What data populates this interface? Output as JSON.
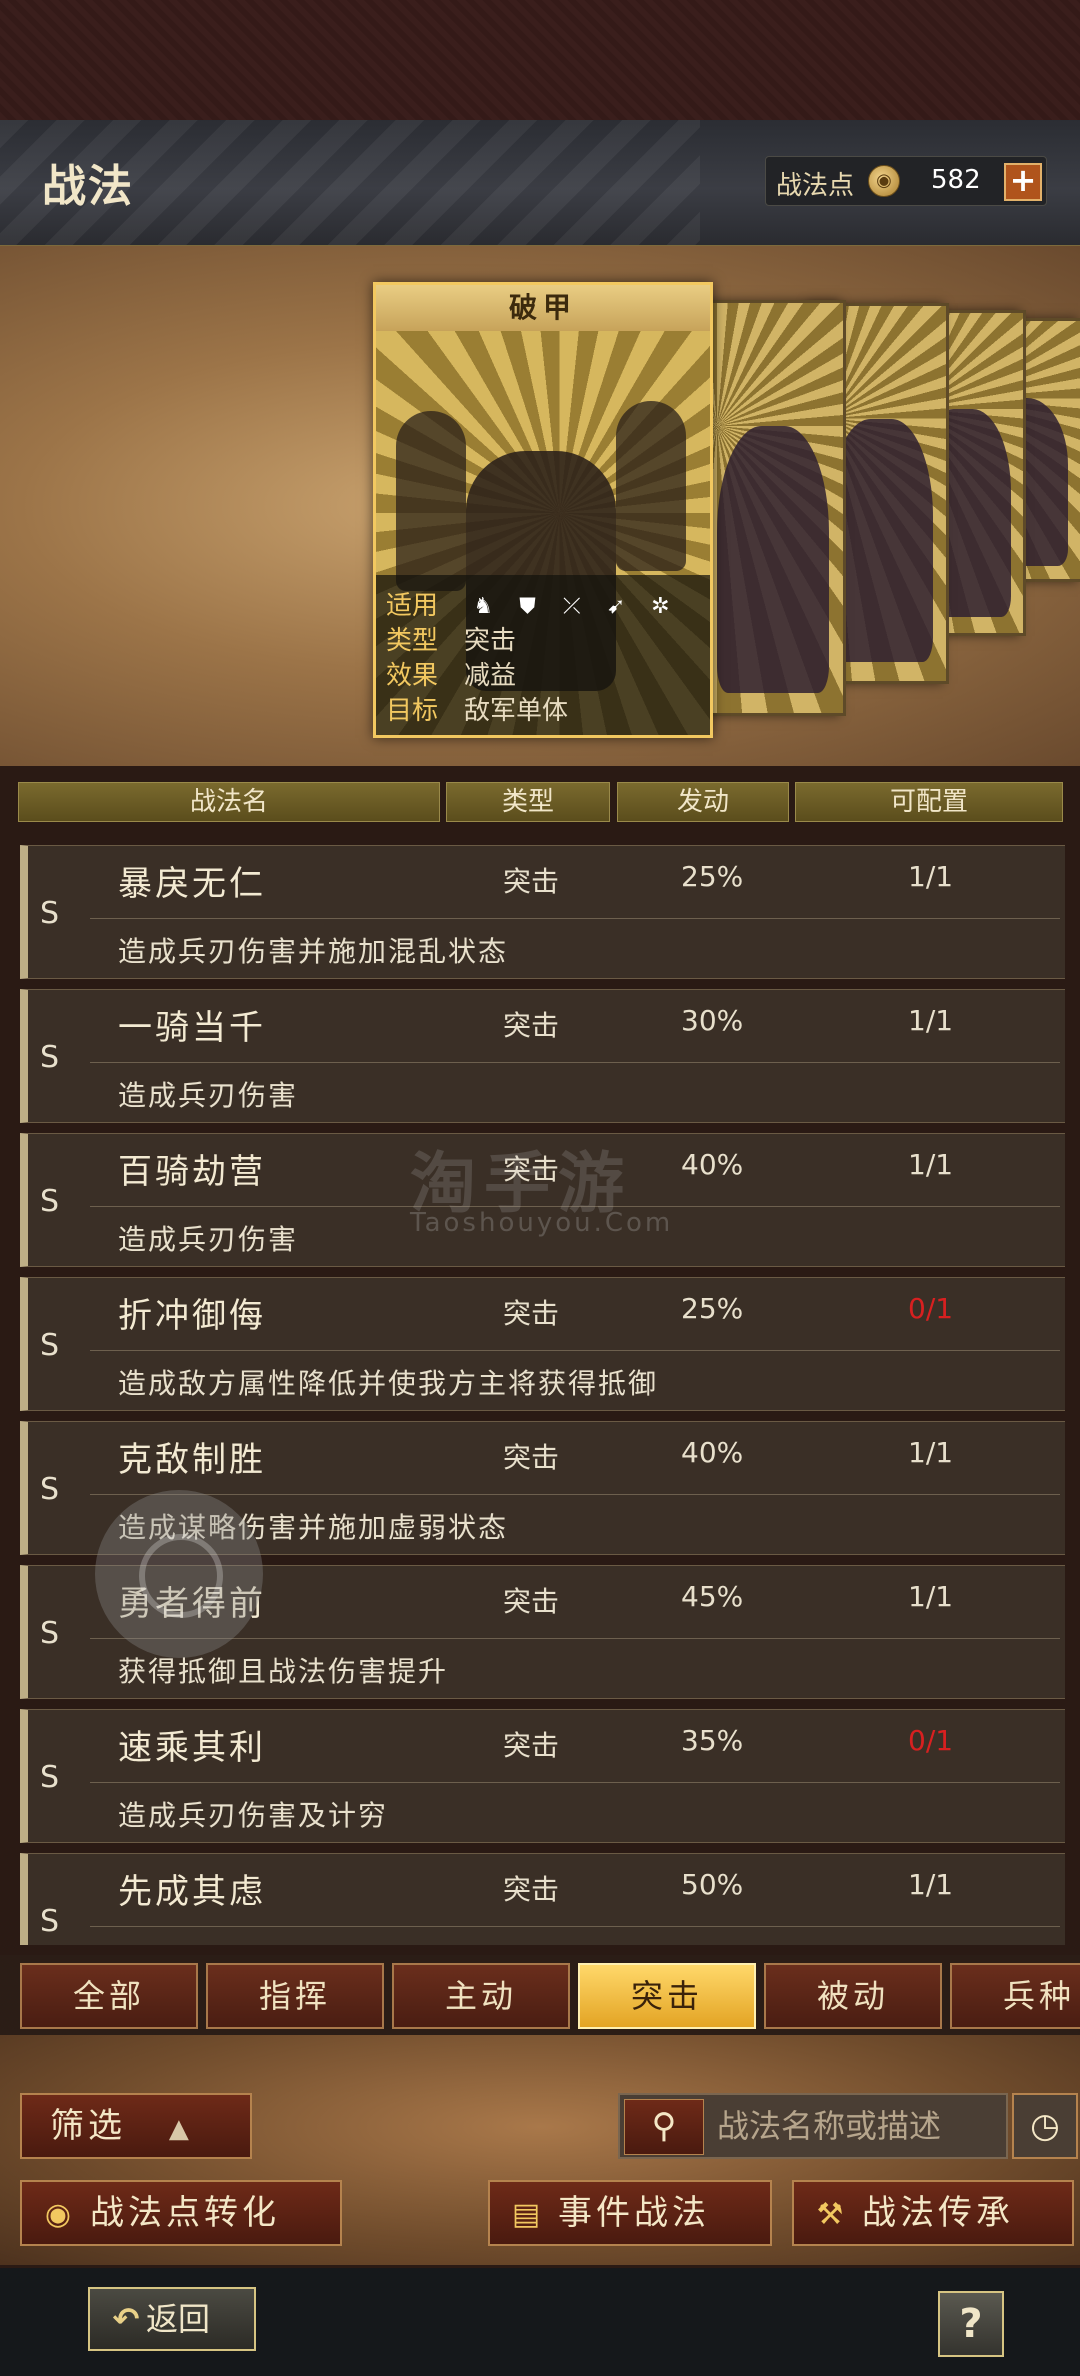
{
  "header": {
    "title": "战法",
    "points_label": "战法点",
    "points_value": "582",
    "plus_label": "+"
  },
  "featured_card": {
    "name": "破甲",
    "rows": [
      {
        "key": "适用",
        "value": ""
      },
      {
        "key": "类型",
        "value": "突击"
      },
      {
        "key": "效果",
        "value": "减益"
      },
      {
        "key": "目标",
        "value": "敌军单体"
      }
    ],
    "unit_icons": [
      "cavalry-icon",
      "shield-icon",
      "bow-icon",
      "spear-icon",
      "wheel-icon"
    ]
  },
  "table_headers": {
    "name": "战法名",
    "type": "类型",
    "rate": "发动",
    "config": "可配置"
  },
  "skills": [
    {
      "grade": "S",
      "name": "暴戾无仁",
      "type": "突击",
      "rate": "25%",
      "config": "1/1",
      "config_red": false,
      "desc": "造成兵刃伤害并施加混乱状态"
    },
    {
      "grade": "S",
      "name": "一骑当千",
      "type": "突击",
      "rate": "30%",
      "config": "1/1",
      "config_red": false,
      "desc": "造成兵刃伤害"
    },
    {
      "grade": "S",
      "name": "百骑劫营",
      "type": "突击",
      "rate": "40%",
      "config": "1/1",
      "config_red": false,
      "desc": "造成兵刃伤害"
    },
    {
      "grade": "S",
      "name": "折冲御侮",
      "type": "突击",
      "rate": "25%",
      "config": "0/1",
      "config_red": true,
      "desc": "造成敌方属性降低并使我方主将获得抵御"
    },
    {
      "grade": "S",
      "name": "克敌制胜",
      "type": "突击",
      "rate": "40%",
      "config": "1/1",
      "config_red": false,
      "desc": "造成谋略伤害并施加虚弱状态"
    },
    {
      "grade": "S",
      "name": "勇者得前",
      "type": "突击",
      "rate": "45%",
      "config": "1/1",
      "config_red": false,
      "desc": "获得抵御且战法伤害提升"
    },
    {
      "grade": "S",
      "name": "速乘其利",
      "type": "突击",
      "rate": "35%",
      "config": "0/1",
      "config_red": true,
      "desc": "造成兵刃伤害及计穷"
    },
    {
      "grade": "S",
      "name": "先成其虑",
      "type": "突击",
      "rate": "50%",
      "config": "1/1",
      "config_red": false,
      "desc": ""
    }
  ],
  "watermark": {
    "cn": "淘手游",
    "en": "Taoshouyou.Com"
  },
  "tabs": [
    "全部",
    "指挥",
    "主动",
    "突击",
    "被动",
    "兵种"
  ],
  "active_tab": "突击",
  "filter_label": "筛选",
  "search_placeholder": "战法名称或描述",
  "buttons": {
    "convert": "战法点转化",
    "event": "事件战法",
    "inherit": "战法传承"
  },
  "back_label": "返回",
  "help_label": "?",
  "colors": {
    "accent_gold": "#f2c860",
    "active_tab": "#ffd86a",
    "red_config": "#d82020"
  }
}
